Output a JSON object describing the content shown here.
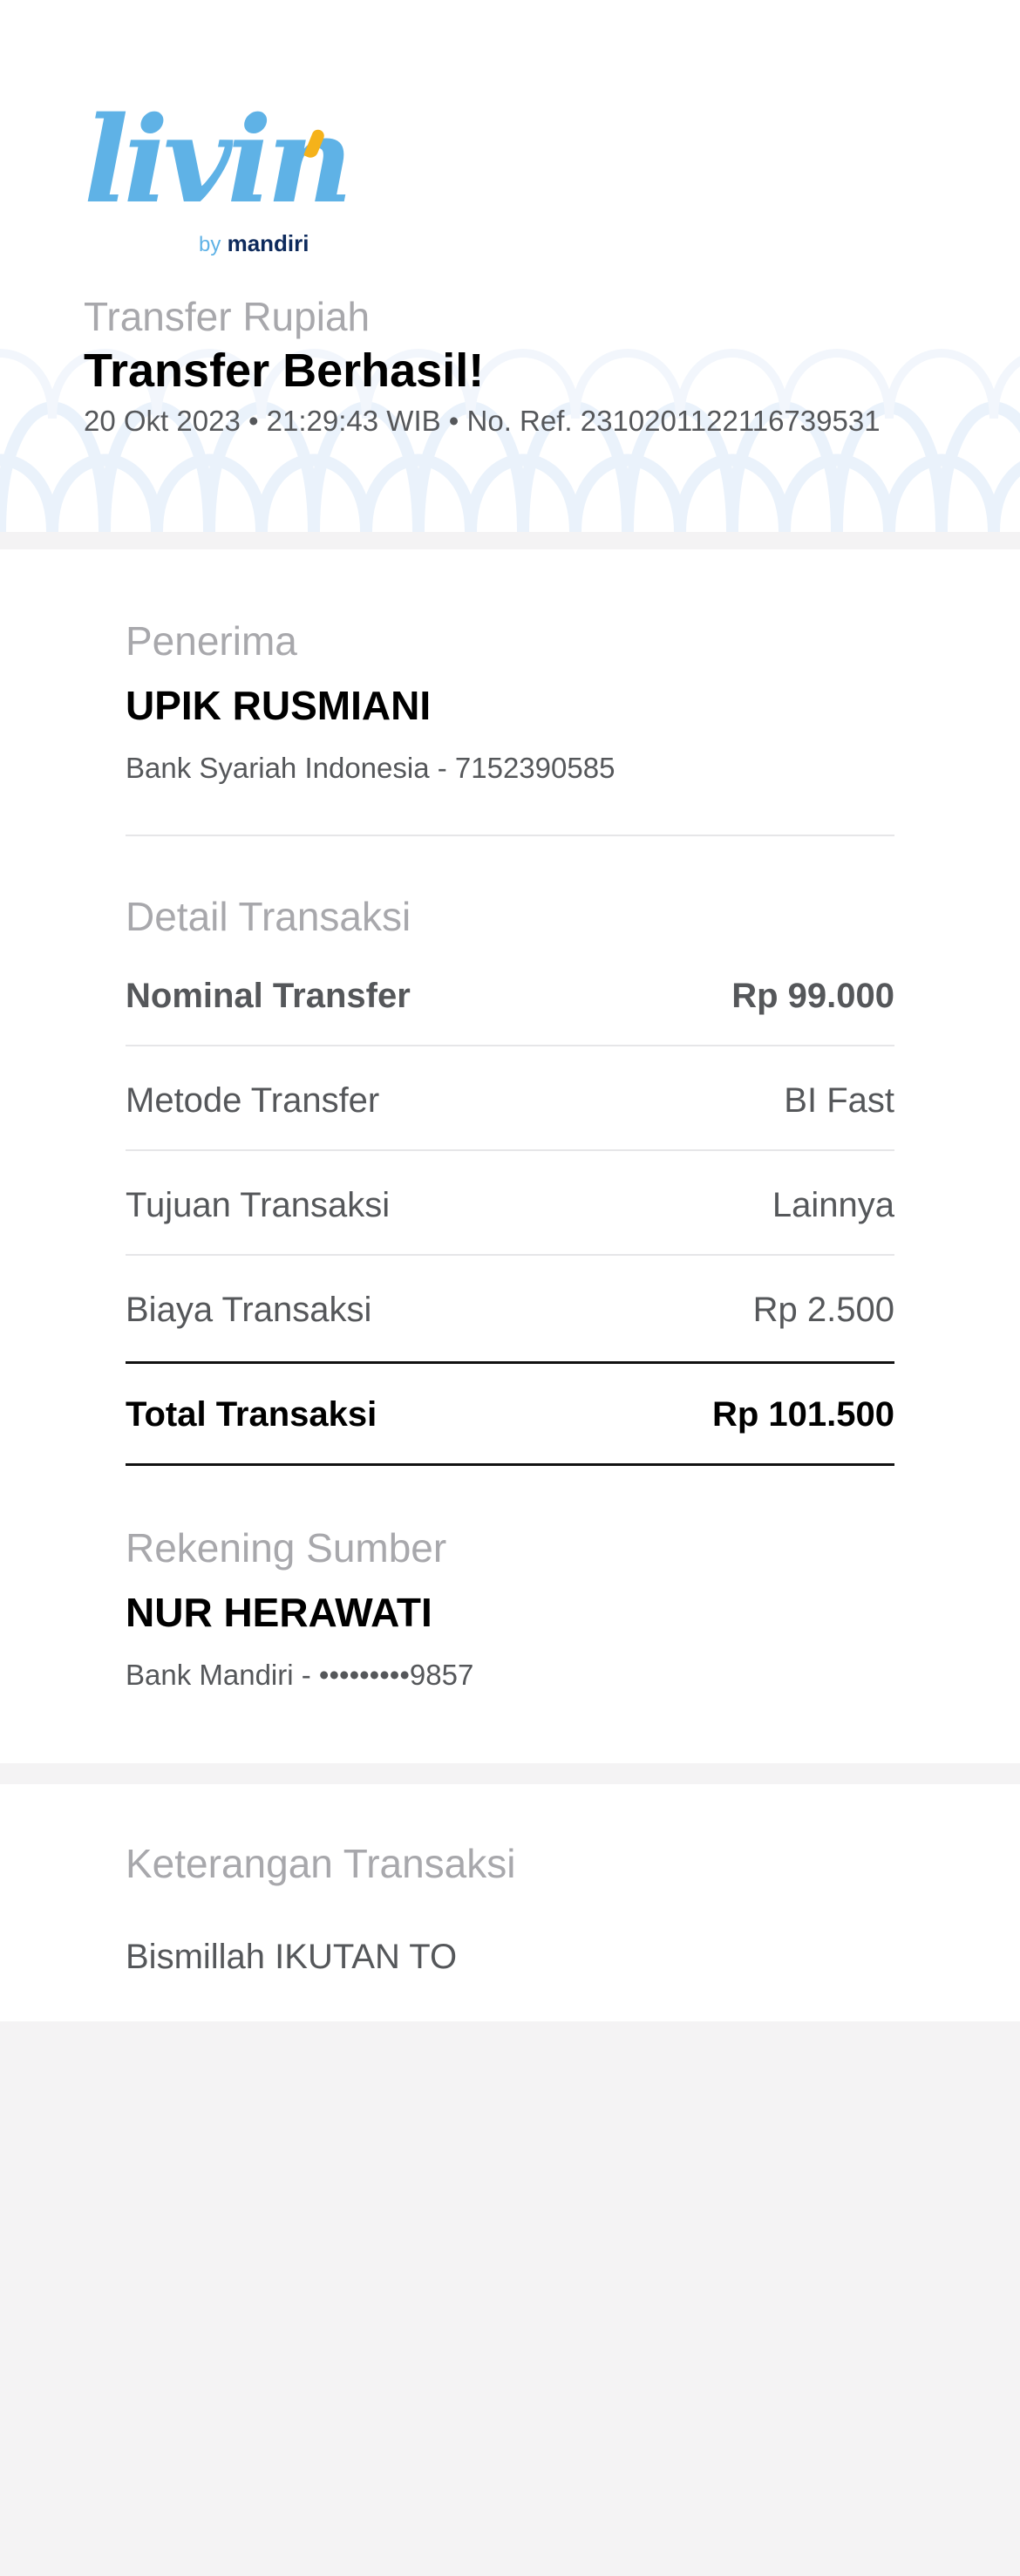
{
  "brand": {
    "logo_word": "livin",
    "logo_by": "by",
    "logo_brand": "mandiri"
  },
  "header": {
    "subtitle": "Transfer Rupiah",
    "title": "Transfer Berhasil!",
    "meta": "20 Okt 2023 • 21:29:43 WIB • No. Ref. 2310201122116739531"
  },
  "recipient": {
    "section_title": "Penerima",
    "name": "UPIK RUSMIANI",
    "bank_line": "Bank Syariah Indonesia - 7152390585"
  },
  "details": {
    "section_title": "Detail Transaksi",
    "rows": [
      {
        "label": "Nominal Transfer",
        "value": "Rp 99.000"
      },
      {
        "label": "Metode Transfer",
        "value": "BI Fast"
      },
      {
        "label": "Tujuan Transaksi",
        "value": "Lainnya"
      },
      {
        "label": "Biaya Transaksi",
        "value": "Rp 2.500"
      }
    ],
    "total": {
      "label": "Total Transaksi",
      "value": "Rp 101.500"
    }
  },
  "source": {
    "section_title": "Rekening Sumber",
    "name": "NUR HERAWATI",
    "bank_line": "Bank Mandiri - •••••••••9857"
  },
  "note": {
    "section_title": "Keterangan Transaksi",
    "text": "Bismillah IKUTAN TO"
  },
  "colors": {
    "logo_blue": "#5fb2e6",
    "logo_yellow": "#f5b21a",
    "brand_navy": "#0d2a5c",
    "muted_text": "#a8a8ac",
    "body_text": "#55575a",
    "background": "#f4f3f4"
  }
}
